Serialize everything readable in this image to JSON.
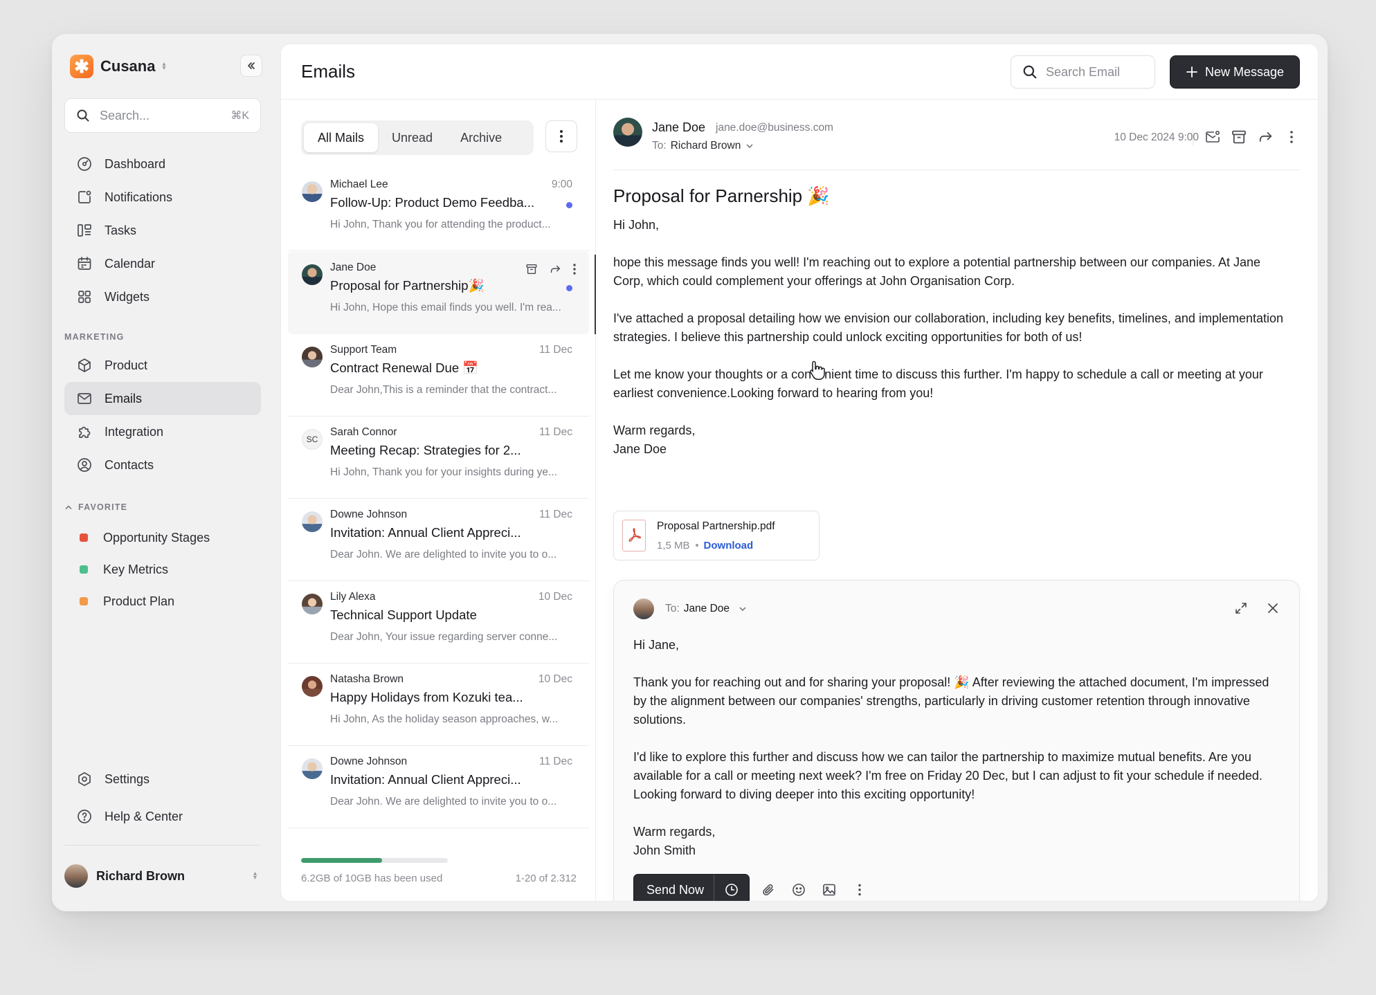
{
  "app": {
    "name": "Cusana"
  },
  "sidebar": {
    "search": {
      "placeholder": "Search...",
      "shortcut": "⌘K"
    },
    "main_nav": [
      {
        "label": "Dashboard",
        "icon": "dashboard-icon"
      },
      {
        "label": "Notifications",
        "icon": "notification-icon"
      },
      {
        "label": "Tasks",
        "icon": "tasks-icon"
      },
      {
        "label": "Calendar",
        "icon": "calendar-icon"
      },
      {
        "label": "Widgets",
        "icon": "widgets-icon"
      }
    ],
    "marketing_label": "MARKETING",
    "marketing_nav": [
      {
        "label": "Product",
        "icon": "box-icon"
      },
      {
        "label": "Emails",
        "icon": "mail-icon",
        "active": true
      },
      {
        "label": "Integration",
        "icon": "puzzle-icon"
      },
      {
        "label": "Contacts",
        "icon": "user-circle-icon"
      }
    ],
    "favorite_label": "FAVORITE",
    "favorites": [
      {
        "label": "Opportunity Stages",
        "color": "#e5533d"
      },
      {
        "label": "Key Metrics",
        "color": "#4dbf8d"
      },
      {
        "label": "Product Plan",
        "color": "#f29a4a"
      }
    ],
    "bottom_nav": [
      {
        "label": "Settings",
        "icon": "settings-icon"
      },
      {
        "label": "Help & Center",
        "icon": "help-icon"
      }
    ],
    "user": {
      "name": "Richard Brown"
    }
  },
  "header": {
    "title": "Emails",
    "search_placeholder": "Search Email",
    "new_message_label": "New Message"
  },
  "mail_list": {
    "tabs": [
      "All Mails",
      "Unread",
      "Archive"
    ],
    "active_tab": "All Mails",
    "items": [
      {
        "sender": "Michael Lee",
        "time": "9:00",
        "subject": "Follow-Up: Product Demo Feedba...",
        "preview": "Hi John, Thank you for attending the product...",
        "unread": true
      },
      {
        "sender": "Jane Doe",
        "time": "",
        "subject": "Proposal for Partnership🎉",
        "preview": "Hi John, Hope this email finds you well. I'm rea...",
        "unread": true,
        "hovered": true
      },
      {
        "sender": "Support Team",
        "time": "11 Dec",
        "subject": "Contract Renewal Due 📅",
        "preview": "Dear John,This is a reminder that the contract..."
      },
      {
        "sender": "Sarah Connor",
        "time": "11 Dec",
        "subject": "Meeting Recap: Strategies for 2...",
        "preview": "Hi John, Thank you for your insights during ye...",
        "initials": "SC"
      },
      {
        "sender": "Downe Johnson",
        "time": "11 Dec",
        "subject": "Invitation: Annual Client Appreci...",
        "preview": "Dear John. We are delighted to invite you to o..."
      },
      {
        "sender": "Lily Alexa",
        "time": "10 Dec",
        "subject": "Technical Support Update",
        "preview": "Dear John, Your issue regarding server conne..."
      },
      {
        "sender": "Natasha Brown",
        "time": "10 Dec",
        "subject": "Happy Holidays from Kozuki tea...",
        "preview": "Hi John, As the holiday season approaches, w..."
      },
      {
        "sender": "Downe Johnson",
        "time": "11 Dec",
        "subject": "Invitation: Annual Client Appreci...",
        "preview": "Dear John. We are delighted to invite you to o..."
      }
    ],
    "storage": {
      "used_text": "6.2GB of 10GB has been used",
      "used_fraction": 0.55,
      "range_text": "1-20 of 2.312"
    }
  },
  "email": {
    "sender_name": "Jane Doe",
    "sender_email": "jane.doe@business.com",
    "to_label": "To:",
    "to_name": "Richard Brown",
    "date": "10 Dec 2024 9:00",
    "subject": "Proposal for Parnership 🎉",
    "body": [
      "Hi John,",
      "hope this message finds you well! I'm reaching out to explore a potential partnership between our companies. At Jane Corp, which could complement your offerings at John Organisation Corp.",
      "I've attached a proposal detailing how we envision our collaboration, including key benefits, timelines, and implementation strategies. I believe this partnership could unlock exciting opportunities for both of us!",
      "Let me know your thoughts or a convenient time to discuss this further. I'm happy to schedule a call or meeting at your earliest convenience.Looking forward to hearing from you!"
    ],
    "signoff": "Warm regards,",
    "signature": "Jane Doe",
    "attachment": {
      "name": "Proposal Partnership.pdf",
      "size": "1,5 MB",
      "action": "Download"
    }
  },
  "reply": {
    "to_label": "To:",
    "to_name": "Jane Doe",
    "greeting": "Hi Jane,",
    "paragraphs": [
      "Thank you for reaching out and for sharing your proposal! 🎉 After reviewing the attached document, I'm impressed by the alignment between our companies' strengths, particularly in driving customer retention through innovative solutions.",
      "I'd like to explore this further and discuss how we can tailor the partnership to maximize mutual benefits. Are you available for a call or meeting next week? I'm free on Friday 20 Dec, but I can adjust to fit your schedule if needed. Looking forward to diving deeper into this exciting opportunity!"
    ],
    "signoff": "Warm regards,",
    "signature": "John Smith",
    "send_label": "Send Now"
  }
}
